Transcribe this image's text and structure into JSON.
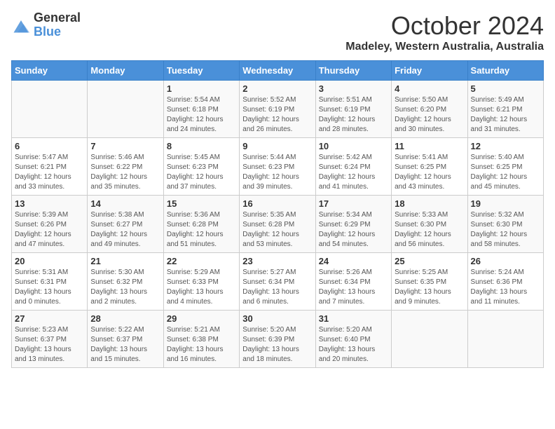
{
  "logo": {
    "general": "General",
    "blue": "Blue"
  },
  "title": "October 2024",
  "location": "Madeley, Western Australia, Australia",
  "weekdays": [
    "Sunday",
    "Monday",
    "Tuesday",
    "Wednesday",
    "Thursday",
    "Friday",
    "Saturday"
  ],
  "weeks": [
    [
      {
        "day": "",
        "content": ""
      },
      {
        "day": "",
        "content": ""
      },
      {
        "day": "1",
        "content": "Sunrise: 5:54 AM\nSunset: 6:18 PM\nDaylight: 12 hours and 24 minutes."
      },
      {
        "day": "2",
        "content": "Sunrise: 5:52 AM\nSunset: 6:19 PM\nDaylight: 12 hours and 26 minutes."
      },
      {
        "day": "3",
        "content": "Sunrise: 5:51 AM\nSunset: 6:19 PM\nDaylight: 12 hours and 28 minutes."
      },
      {
        "day": "4",
        "content": "Sunrise: 5:50 AM\nSunset: 6:20 PM\nDaylight: 12 hours and 30 minutes."
      },
      {
        "day": "5",
        "content": "Sunrise: 5:49 AM\nSunset: 6:21 PM\nDaylight: 12 hours and 31 minutes."
      }
    ],
    [
      {
        "day": "6",
        "content": "Sunrise: 5:47 AM\nSunset: 6:21 PM\nDaylight: 12 hours and 33 minutes."
      },
      {
        "day": "7",
        "content": "Sunrise: 5:46 AM\nSunset: 6:22 PM\nDaylight: 12 hours and 35 minutes."
      },
      {
        "day": "8",
        "content": "Sunrise: 5:45 AM\nSunset: 6:23 PM\nDaylight: 12 hours and 37 minutes."
      },
      {
        "day": "9",
        "content": "Sunrise: 5:44 AM\nSunset: 6:23 PM\nDaylight: 12 hours and 39 minutes."
      },
      {
        "day": "10",
        "content": "Sunrise: 5:42 AM\nSunset: 6:24 PM\nDaylight: 12 hours and 41 minutes."
      },
      {
        "day": "11",
        "content": "Sunrise: 5:41 AM\nSunset: 6:25 PM\nDaylight: 12 hours and 43 minutes."
      },
      {
        "day": "12",
        "content": "Sunrise: 5:40 AM\nSunset: 6:25 PM\nDaylight: 12 hours and 45 minutes."
      }
    ],
    [
      {
        "day": "13",
        "content": "Sunrise: 5:39 AM\nSunset: 6:26 PM\nDaylight: 12 hours and 47 minutes."
      },
      {
        "day": "14",
        "content": "Sunrise: 5:38 AM\nSunset: 6:27 PM\nDaylight: 12 hours and 49 minutes."
      },
      {
        "day": "15",
        "content": "Sunrise: 5:36 AM\nSunset: 6:28 PM\nDaylight: 12 hours and 51 minutes."
      },
      {
        "day": "16",
        "content": "Sunrise: 5:35 AM\nSunset: 6:28 PM\nDaylight: 12 hours and 53 minutes."
      },
      {
        "day": "17",
        "content": "Sunrise: 5:34 AM\nSunset: 6:29 PM\nDaylight: 12 hours and 54 minutes."
      },
      {
        "day": "18",
        "content": "Sunrise: 5:33 AM\nSunset: 6:30 PM\nDaylight: 12 hours and 56 minutes."
      },
      {
        "day": "19",
        "content": "Sunrise: 5:32 AM\nSunset: 6:30 PM\nDaylight: 12 hours and 58 minutes."
      }
    ],
    [
      {
        "day": "20",
        "content": "Sunrise: 5:31 AM\nSunset: 6:31 PM\nDaylight: 13 hours and 0 minutes."
      },
      {
        "day": "21",
        "content": "Sunrise: 5:30 AM\nSunset: 6:32 PM\nDaylight: 13 hours and 2 minutes."
      },
      {
        "day": "22",
        "content": "Sunrise: 5:29 AM\nSunset: 6:33 PM\nDaylight: 13 hours and 4 minutes."
      },
      {
        "day": "23",
        "content": "Sunrise: 5:27 AM\nSunset: 6:34 PM\nDaylight: 13 hours and 6 minutes."
      },
      {
        "day": "24",
        "content": "Sunrise: 5:26 AM\nSunset: 6:34 PM\nDaylight: 13 hours and 7 minutes."
      },
      {
        "day": "25",
        "content": "Sunrise: 5:25 AM\nSunset: 6:35 PM\nDaylight: 13 hours and 9 minutes."
      },
      {
        "day": "26",
        "content": "Sunrise: 5:24 AM\nSunset: 6:36 PM\nDaylight: 13 hours and 11 minutes."
      }
    ],
    [
      {
        "day": "27",
        "content": "Sunrise: 5:23 AM\nSunset: 6:37 PM\nDaylight: 13 hours and 13 minutes."
      },
      {
        "day": "28",
        "content": "Sunrise: 5:22 AM\nSunset: 6:37 PM\nDaylight: 13 hours and 15 minutes."
      },
      {
        "day": "29",
        "content": "Sunrise: 5:21 AM\nSunset: 6:38 PM\nDaylight: 13 hours and 16 minutes."
      },
      {
        "day": "30",
        "content": "Sunrise: 5:20 AM\nSunset: 6:39 PM\nDaylight: 13 hours and 18 minutes."
      },
      {
        "day": "31",
        "content": "Sunrise: 5:20 AM\nSunset: 6:40 PM\nDaylight: 13 hours and 20 minutes."
      },
      {
        "day": "",
        "content": ""
      },
      {
        "day": "",
        "content": ""
      }
    ]
  ]
}
